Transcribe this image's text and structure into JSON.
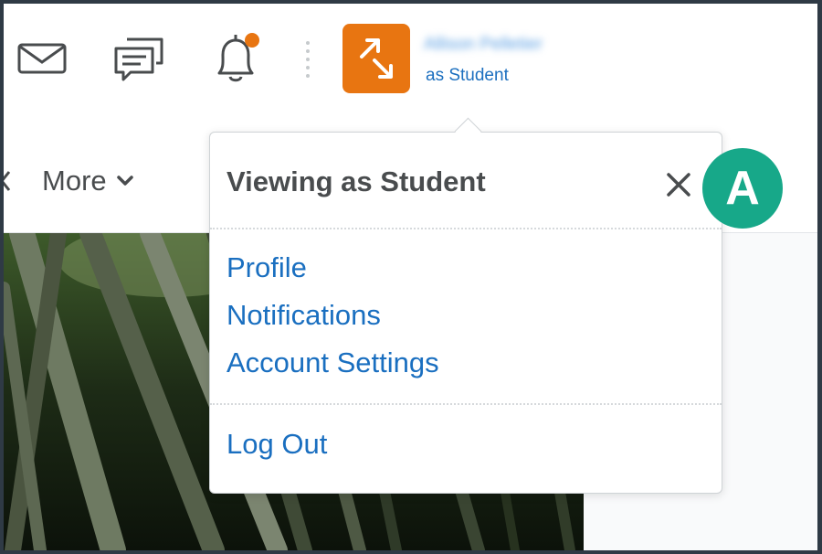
{
  "header": {
    "user_name": "Allison Pelletier",
    "role_label": "as Student",
    "notification_badge_color": "#e87511",
    "role_tile_color": "#e87511",
    "icons": [
      "mail-icon",
      "chat-icon",
      "bell-icon",
      "role-switch-icon"
    ]
  },
  "nav": {
    "more_label": "More"
  },
  "dropdown": {
    "title": "Viewing as Student",
    "items": [
      {
        "label": "Profile"
      },
      {
        "label": "Notifications"
      },
      {
        "label": "Account Settings"
      }
    ],
    "logout_label": "Log Out"
  },
  "callout": {
    "letter": "A",
    "color": "#17a889"
  },
  "colors": {
    "link": "#1a6fc0",
    "text": "#494c4e",
    "frame": "#2f3a45"
  }
}
